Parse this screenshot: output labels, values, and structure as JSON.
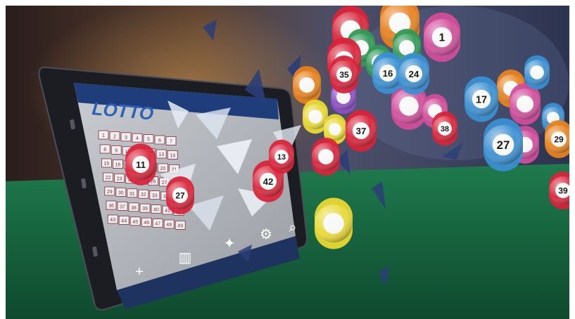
{
  "tablet": {
    "logo": "LOTTO",
    "grid_numbers": [
      [
        "1",
        "2",
        "3",
        "4",
        "5",
        "6",
        "7"
      ],
      [
        "8",
        "9",
        "10",
        "11",
        "12",
        "13",
        "14"
      ],
      [
        "15",
        "16",
        "17",
        "18",
        "19",
        "20",
        "21"
      ],
      [
        "22",
        "23",
        "24",
        "25",
        "26",
        "27",
        "28"
      ],
      [
        "29",
        "30",
        "31",
        "32",
        "33",
        "34",
        "35"
      ],
      [
        "36",
        "37",
        "38",
        "39",
        "40",
        "41",
        "42"
      ],
      [
        "43",
        "44",
        "45",
        "46",
        "47",
        "48",
        "49"
      ]
    ],
    "toolbar": [
      "plus-icon",
      "chart-icon",
      "wand-icon",
      "search-settings-icon",
      "search-icon"
    ]
  },
  "balls": [
    {
      "label": "11",
      "color": "#d8243a"
    },
    {
      "label": "42",
      "color": "#d8243a"
    },
    {
      "label": "13",
      "color": "#d8243a"
    },
    {
      "label": "",
      "color": "#e8d832"
    },
    {
      "label": "27",
      "color": "#d8243a"
    },
    {
      "label": "1",
      "color": "#d14d9a"
    },
    {
      "label": "5",
      "color": "#d8243a"
    },
    {
      "label": "35",
      "color": "#d8243a"
    },
    {
      "label": "16",
      "color": "#3a8fd2"
    },
    {
      "label": "24",
      "color": "#3a8fd2"
    },
    {
      "label": "37",
      "color": "#d8243a"
    },
    {
      "label": "38",
      "color": "#d8243a"
    },
    {
      "label": "17",
      "color": "#3a8fd2"
    },
    {
      "label": "27",
      "color": "#3a8fd2"
    },
    {
      "label": "29",
      "color": "#e8821e"
    },
    {
      "label": "39",
      "color": "#d8243a"
    }
  ]
}
